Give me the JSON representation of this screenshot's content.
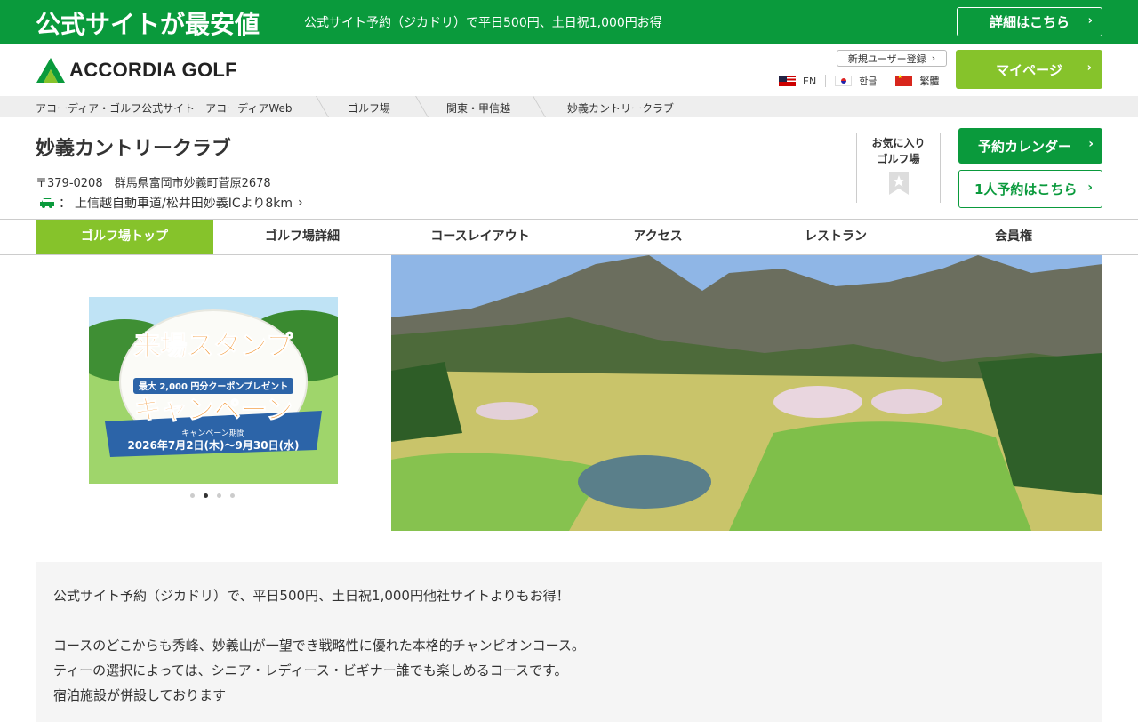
{
  "promo_bar": {
    "headline": "公式サイトが最安値",
    "subtext": "公式サイト予約（ジカドリ）で平日500円、土日祝1,000円お得",
    "detail_button": "詳細はこちら"
  },
  "header": {
    "logo_text": "ACCORDIA GOLF",
    "register_link": "新規ユーザー登録",
    "languages": [
      {
        "label": "EN",
        "flag": "us-flag-icon"
      },
      {
        "label": "한글",
        "flag": "kr-flag-icon"
      },
      {
        "label": "繁體",
        "flag": "cn-flag-icon"
      }
    ],
    "mypage_button": "マイページ"
  },
  "breadcrumb": [
    "アコーディア・ゴルフ公式サイト　アコーディアWeb",
    "ゴルフ場",
    "関東・甲信越",
    "妙義カントリークラブ"
  ],
  "club": {
    "name": "妙義カントリークラブ",
    "address": "〒379-0208　群馬県富岡市妙義町菅原2678",
    "access_prefix": "：",
    "access": "上信越自動車道/松井田妙義ICより8km",
    "favorite_line1": "お気に入り",
    "favorite_line2": "ゴルフ場",
    "calendar_button": "予約カレンダー",
    "single_button": "1人予約はこちら"
  },
  "tabs": [
    "ゴルフ場トップ",
    "ゴルフ場詳細",
    "コースレイアウト",
    "アクセス",
    "レストラン",
    "会員権"
  ],
  "active_tab": 0,
  "carousel": {
    "title_line1": "来場スタンプ",
    "badge": "最大 2,000 円分クーポンプレゼント",
    "title_line2": "キャンペーン",
    "period_label": "キャンペーン期間",
    "period": "2026年7月2日(木)〜9月30日(水)",
    "slide_count": 4,
    "active_slide": 1
  },
  "description": [
    "公式サイト予約（ジカドリ）で、平日500円、土日祝1,000円他社サイトよりもお得！",
    "",
    "コースのどこからも秀峰、妙義山が一望でき戦略性に優れた本格的チャンピオンコース。",
    "ティーの選択によっては、シニア・レディース・ビギナー誰でも楽しめるコースです。",
    "宿泊施設が併設しております"
  ],
  "colors": {
    "brand_green": "#0a9a3c",
    "accent_lime": "#86c32b"
  }
}
